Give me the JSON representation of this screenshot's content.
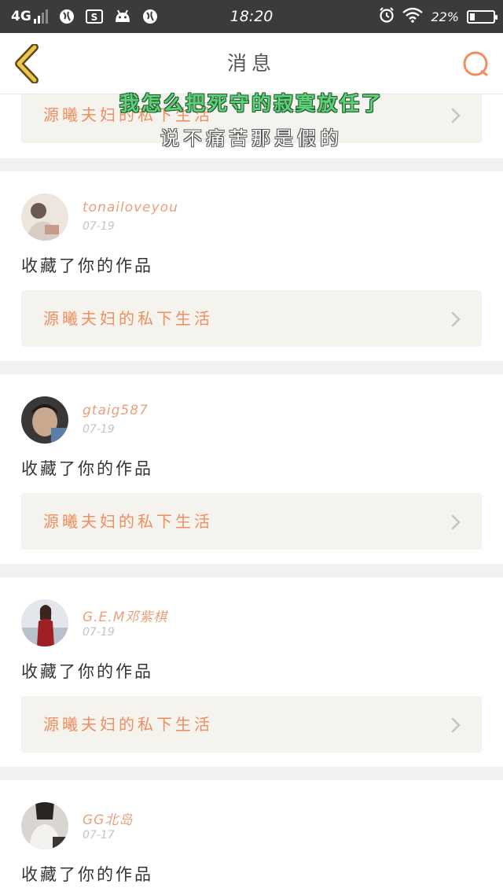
{
  "status_bar": {
    "network": "4G",
    "time": "18:20",
    "battery_text": "22%",
    "battery_level": 0.22,
    "icons": [
      "signal-icon",
      "globe-icon",
      "s-app-icon",
      "android-icon",
      "globe-icon",
      "alarm-icon",
      "wifi-icon",
      "battery-icon"
    ]
  },
  "nav": {
    "title": "消息",
    "back_icon": "chevron-left-icon",
    "search_icon": "search-icon"
  },
  "captions": {
    "line1": "我怎么把死守的寂寞放任了",
    "line2": "说不痛苦那是假的"
  },
  "colors": {
    "accent": "#ef8e5f",
    "username": "#e8a27a",
    "card_bg": "#ffffff",
    "feed_bg": "#f1f1f1",
    "work_bg": "#f4f3ee"
  },
  "partial_top": {
    "work_title": "源曦夫妇的私下生活"
  },
  "messages": [
    {
      "username": "tonailoveyou",
      "date": "07-19",
      "action": "收藏了你的作品",
      "work_title": "源曦夫妇的私下生活"
    },
    {
      "username": "gtaig587",
      "date": "07-19",
      "action": "收藏了你的作品",
      "work_title": "源曦夫妇的私下生活"
    },
    {
      "username": "G.E.M邓紫棋",
      "date": "07-19",
      "action": "收藏了你的作品",
      "work_title": "源曦夫妇的私下生活"
    },
    {
      "username": "GG北岛",
      "date": "07-17",
      "action": "收藏了你的作品"
    }
  ]
}
